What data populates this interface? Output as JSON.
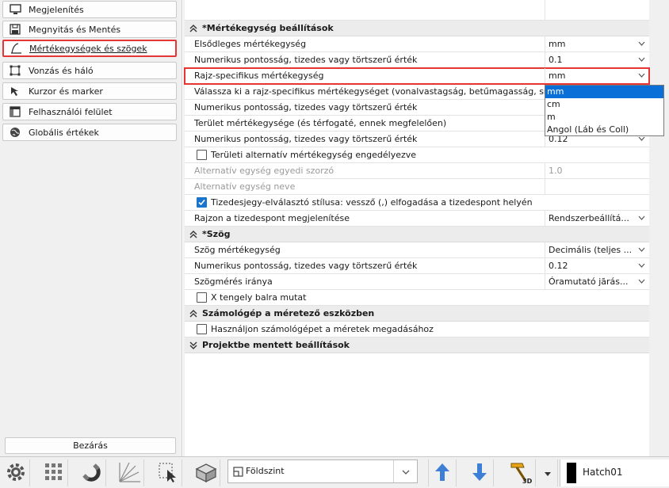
{
  "sidebar": {
    "items": [
      {
        "label": "Megjelenítés",
        "icon": "monitor-icon"
      },
      {
        "label": "Megnyitás és Mentés",
        "icon": "floppy-icon"
      },
      {
        "label": "Mértékegységek és szögek",
        "icon": "angle-icon",
        "selected": true
      },
      {
        "label": "Vonzás és háló",
        "icon": "snap-grid-icon"
      },
      {
        "label": "Kurzor és marker",
        "icon": "cursor-icon"
      },
      {
        "label": "Felhasználói felület",
        "icon": "window-icon"
      },
      {
        "label": "Globális értékek",
        "icon": "globe-icon"
      }
    ],
    "close_label": "Bezárás"
  },
  "settings": {
    "units_section": "*Mértékegység beállítások",
    "primary_unit_label": "Elsődleges mértékegység",
    "primary_unit_value": "mm",
    "primary_precision_label": "Numerikus pontosság, tizedes vagy törtszerű érték",
    "primary_precision_value": "0.1",
    "drawing_unit_label": "Rajz-specifikus mértékegység",
    "drawing_unit_value": "mm",
    "choose_label": "Válassza ki a rajz-specifikus mértékegységet (vonalvastagság, betűmagasság, sraffozás, me",
    "drawing_precision_label": "Numerikus pontosság, tizedes vagy törtszerű érték",
    "area_unit_label": "Terület mértékegysége (és térfogaté, ennek megfelelően)",
    "area_precision_label": "Numerikus pontosság, tizedes vagy törtszerű érték",
    "area_precision_value": "0.12",
    "alt_area_label": "Területi alternatív mértékegység engedélyezve",
    "alt_factor_label": "Alternatív egység egyedi szorzó",
    "alt_factor_value": "1.0",
    "alt_name_label": "Alternatív egység neve",
    "decimal_sep_label": "Tizedesjegy-elválasztó stílusa: vessző (,) elfogadása a tizedespont helyén",
    "decimal_display_label": "Rajzon a tizedespont megjelenítése",
    "decimal_display_value": "Rendszerbeállítá...",
    "angle_section": "*Szög",
    "angle_unit_label": "Szög mértékegység",
    "angle_unit_value": "Decimális (teljes ...",
    "angle_precision_label": "Numerikus pontosság, tizedes vagy törtszerű érték",
    "angle_precision_value": "0.12",
    "angle_dir_label": "Szögmérés iránya",
    "angle_dir_value": "Óramutató jārás...",
    "x_axis_label": "X tengely balra mutat",
    "calc_section": "Számológép a méretező eszközben",
    "calc_label": "Használjon számológépet a méretek megadásához",
    "project_section": "Projektbe mentett beállítások"
  },
  "popup": {
    "options": [
      "mm",
      "cm",
      "m",
      "Angol (Láb és Coll)"
    ],
    "selected": "mm"
  },
  "toolbar": {
    "floor_value": "Földszint",
    "hatch_label": "Hatch01"
  }
}
